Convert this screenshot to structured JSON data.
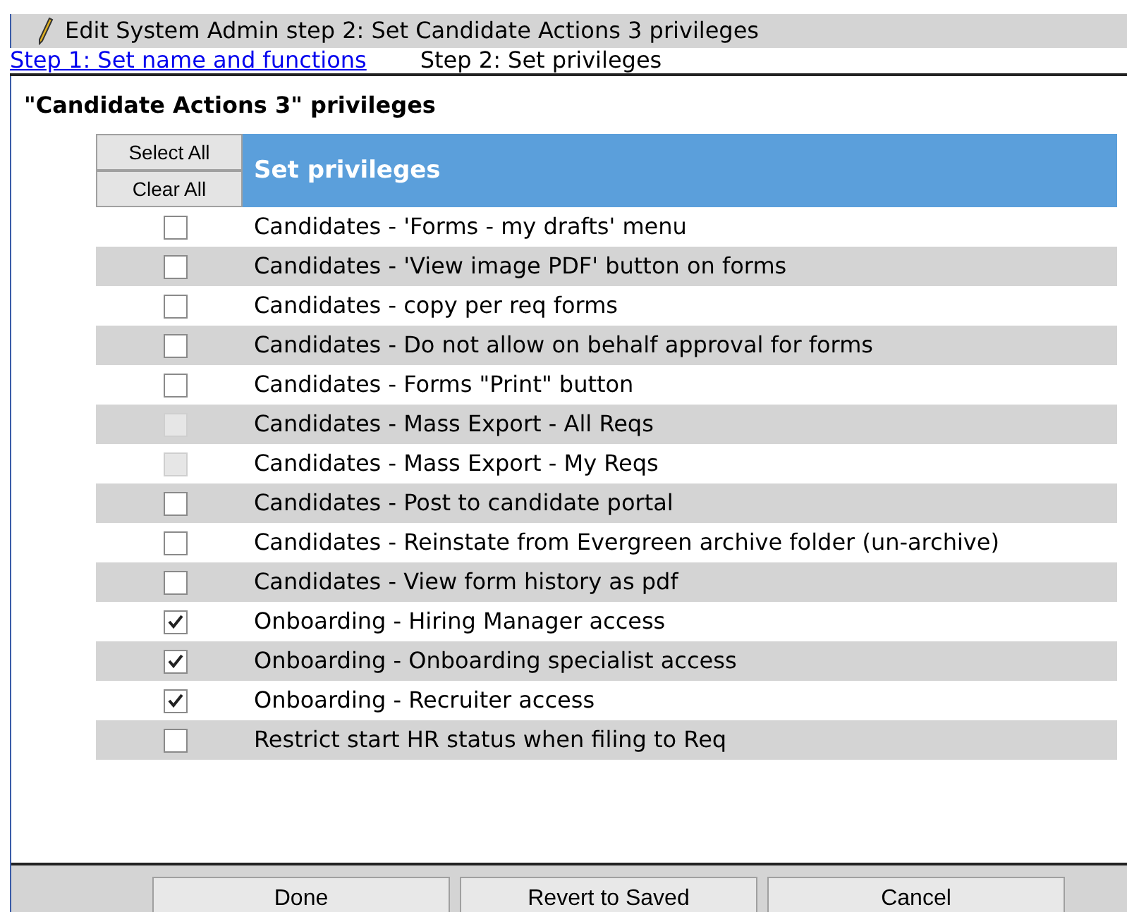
{
  "window": {
    "title": "Edit System Admin step 2: Set Candidate Actions 3 privileges"
  },
  "steps": [
    {
      "label": "Step 1: Set name and functions",
      "kind": "link"
    },
    {
      "label": "Step 2: Set privileges",
      "kind": "current"
    }
  ],
  "heading": "\"Candidate Actions 3\" privileges",
  "table": {
    "select_all": "Select All",
    "clear_all": "Clear All",
    "header": "Set privileges",
    "rows": [
      {
        "label": "Candidates - 'Forms - my drafts' menu",
        "checked": false,
        "disabled": false
      },
      {
        "label": "Candidates - 'View image PDF' button on forms",
        "checked": false,
        "disabled": false
      },
      {
        "label": "Candidates - copy per req forms",
        "checked": false,
        "disabled": false
      },
      {
        "label": "Candidates - Do not allow on behalf approval for forms",
        "checked": false,
        "disabled": false
      },
      {
        "label": "Candidates - Forms \"Print\" button",
        "checked": false,
        "disabled": false
      },
      {
        "label": "Candidates - Mass Export - All Reqs",
        "checked": false,
        "disabled": true
      },
      {
        "label": "Candidates - Mass Export - My Reqs",
        "checked": false,
        "disabled": true
      },
      {
        "label": "Candidates - Post to candidate portal",
        "checked": false,
        "disabled": false
      },
      {
        "label": "Candidates - Reinstate from Evergreen archive folder (un-archive)",
        "checked": false,
        "disabled": false
      },
      {
        "label": "Candidates - View form history as pdf",
        "checked": false,
        "disabled": false
      },
      {
        "label": "Onboarding - Hiring Manager access",
        "checked": true,
        "disabled": false
      },
      {
        "label": "Onboarding - Onboarding specialist access",
        "checked": true,
        "disabled": false
      },
      {
        "label": "Onboarding - Recruiter access",
        "checked": true,
        "disabled": false
      },
      {
        "label": "Restrict start HR status when filing to Req",
        "checked": false,
        "disabled": false
      }
    ]
  },
  "buttons": [
    "Done",
    "Revert to Saved",
    "Cancel"
  ]
}
